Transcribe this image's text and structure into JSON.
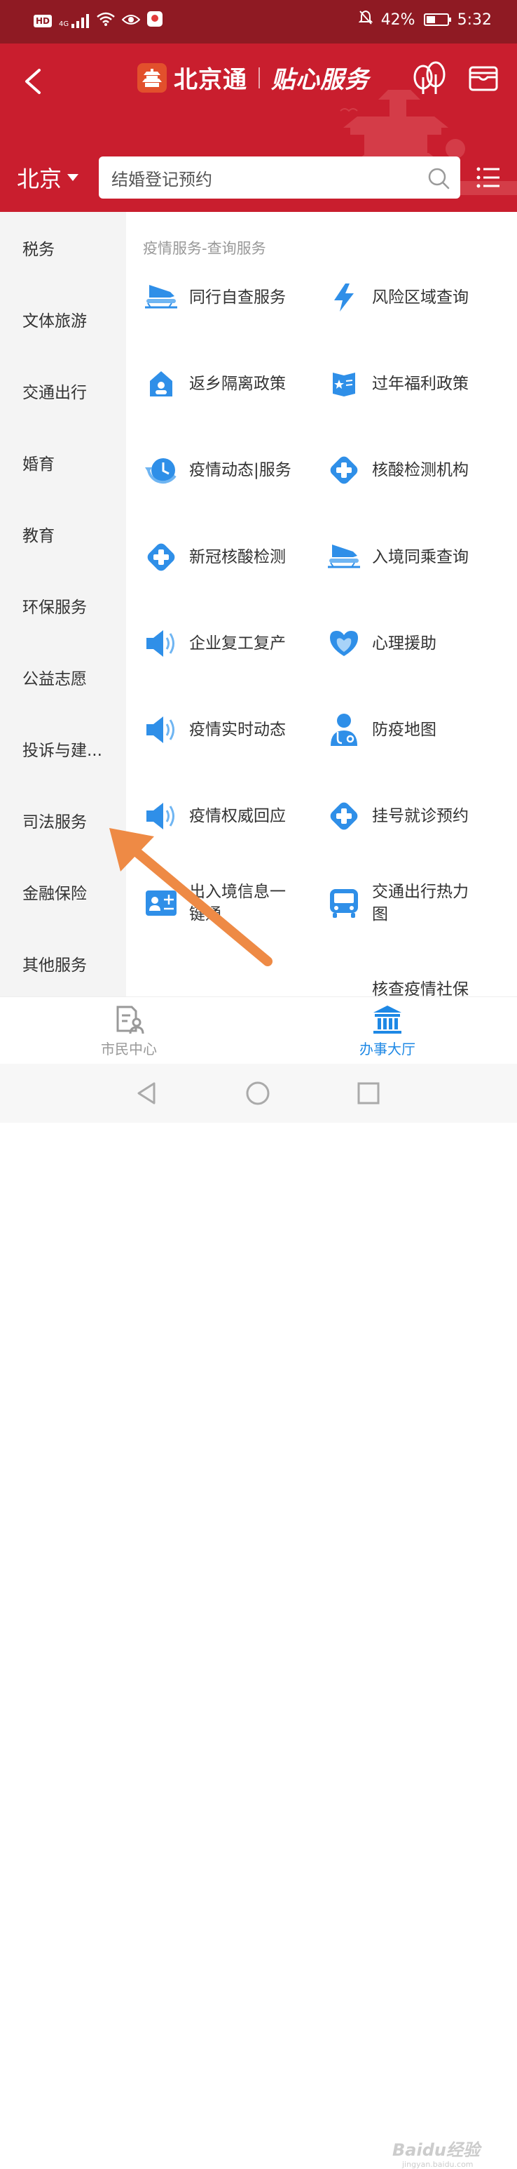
{
  "status_bar": {
    "hd": "HD",
    "signal": "4G",
    "battery": "42%",
    "battery_level": 0.42,
    "time": "5:32"
  },
  "header": {
    "brand_name": "北京通",
    "brand_slogan": "贴心服务"
  },
  "search": {
    "city": "北京",
    "query": "结婚登记预约"
  },
  "sidebar": {
    "items": [
      {
        "label": "税务"
      },
      {
        "label": "文体旅游"
      },
      {
        "label": "交通出行"
      },
      {
        "label": "婚育"
      },
      {
        "label": "教育"
      },
      {
        "label": "环保服务"
      },
      {
        "label": "公益志愿"
      },
      {
        "label": "投诉与建..."
      },
      {
        "label": "司法服务"
      },
      {
        "label": "金融保险"
      },
      {
        "label": "其他服务"
      }
    ]
  },
  "content": {
    "section_title": "疫情服务-查询服务",
    "services": [
      {
        "label": "同行自查服务",
        "icon": "train-icon"
      },
      {
        "label": "风险区域查询",
        "icon": "lightning-icon"
      },
      {
        "label": "返乡隔离政策",
        "icon": "home-person-icon"
      },
      {
        "label": "过年福利政策",
        "icon": "book-icon"
      },
      {
        "label": "疫情动态|服务",
        "icon": "clock-refresh-icon"
      },
      {
        "label": "核酸检测机构",
        "icon": "medical-cross-icon"
      },
      {
        "label": "新冠核酸检测",
        "icon": "medical-cross-icon"
      },
      {
        "label": "入境同乘查询",
        "icon": "train-icon"
      },
      {
        "label": "企业复工复产",
        "icon": "speaker-icon"
      },
      {
        "label": "心理援助",
        "icon": "heart-hands-icon"
      },
      {
        "label": "疫情实时动态",
        "icon": "speaker-icon"
      },
      {
        "label": "防疫地图",
        "icon": "doctor-icon"
      },
      {
        "label": "疫情权威回应",
        "icon": "speaker-icon"
      },
      {
        "label": "挂号就诊预约",
        "icon": "medical-cross-icon"
      },
      {
        "label": "出入境信息一键通",
        "icon": "id-card-icon"
      },
      {
        "label": "交通出行热力图",
        "icon": "bus-icon"
      },
      {
        "label": "核查疫情社保",
        "icon": "none"
      }
    ]
  },
  "bottom_nav": {
    "tabs": [
      {
        "label": "市民中心",
        "icon": "document-person-icon"
      },
      {
        "label": "办事大厅",
        "icon": "government-building-icon"
      }
    ]
  },
  "watermark": {
    "text": "Baidu经验",
    "sub": "jingyan.baidu.com"
  },
  "colors": {
    "status_bar": "#8f1a23",
    "header": "#c91e2e",
    "accent_blue": "#1e88e5",
    "icon_blue": "#2f8fe8",
    "annotation_arrow": "#ee8a45"
  }
}
